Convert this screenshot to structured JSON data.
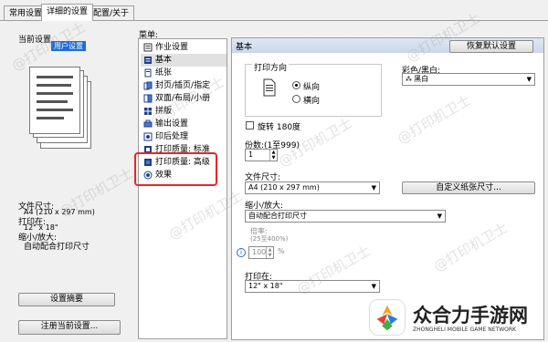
{
  "tabs": [
    "常用设置",
    "详细的设置",
    "配置/关于"
  ],
  "left": {
    "current_settings_label": "当前设置",
    "banner_text": "用户设置",
    "paper_size_label": "文件尺寸:",
    "paper_size_value": "A4 (210 x 297 mm)",
    "print_on_label": "打印在:",
    "print_on_value": "12\" x 18\"",
    "scale_label": "缩小/放大:",
    "scale_value": "自动配合打印尺寸",
    "summary_button": "设置摘要",
    "register_button": "注册当前设置..."
  },
  "menu": {
    "label": "菜单:",
    "items": [
      "作业设置",
      "基本",
      "纸张",
      "封页/插页/指定",
      "双面/布局/小册",
      "拼版",
      "输出设置",
      "印后处理",
      "打印质量: 标准",
      "打印质量: 高级",
      "效果"
    ],
    "selected_index": 1
  },
  "right": {
    "header_title": "基本",
    "restore_button": "恢复默认设置",
    "orientation_label": "打印方向",
    "portrait_label": "纵向",
    "landscape_label": "横向",
    "color_label": "彩色/黑白:",
    "color_value": "黑白",
    "rotate_label": "旋转 180度",
    "copies_label": "份数:(1至999)",
    "copies_value": "1",
    "paper_size_label": "文件尺寸:",
    "paper_size_value": "A4 (210 x 297 mm)",
    "custom_size_button": "自定义纸张尺寸...",
    "scale_label": "缩小/放大:",
    "scale_value": "自动配合打印尺寸",
    "ratio_label": "倍率:",
    "ratio_range": "(25至400%)",
    "ratio_value": "100",
    "print_on_label": "打印在:",
    "print_on_value": "12\" x 18\""
  },
  "watermark": "@打印机卫士",
  "brand": {
    "title": "众合力手游网",
    "subtitle": "ZHONGHELI MOBILE GAME NETWORK"
  },
  "colors": {
    "highlight": "#e5262a",
    "banner": "#1f6dd6"
  }
}
